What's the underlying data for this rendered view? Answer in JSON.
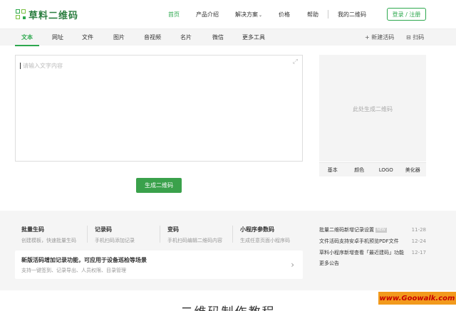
{
  "logo": {
    "text": "草料二维码",
    "icon": "qr-logo-icon"
  },
  "nav": {
    "items": [
      {
        "label": "首页",
        "active": true
      },
      {
        "label": "产品介绍"
      },
      {
        "label": "解决方案"
      },
      {
        "label": "价格"
      },
      {
        "label": "帮助"
      }
    ],
    "dropdown_icon": "⌄",
    "my_qr": "我的二维码",
    "login": "登录 / 注册"
  },
  "tabs": {
    "items": [
      "文本",
      "网址",
      "文件",
      "图片",
      "音视频",
      "名片",
      "微信",
      "更多工具"
    ],
    "active": "文本",
    "new_live": "+ 新建活码",
    "scan": "⊟ 扫码"
  },
  "editor": {
    "placeholder": "请输入文字内容",
    "expand_icon": "⤢"
  },
  "generate_button": "生成二维码",
  "qr_panel": {
    "hint": "此处生成二维码",
    "tabs": [
      "基本",
      "颜色",
      "LOGO",
      "美化器"
    ]
  },
  "features": [
    {
      "title": "批量生码",
      "desc": "创建模板，快速批量生码"
    },
    {
      "title": "记录码",
      "desc": "手机扫码添加记录"
    },
    {
      "title": "变码",
      "desc": "手机扫码编辑二维码内容"
    },
    {
      "title": "小程序参数码",
      "desc": "生成任意页面小程序码"
    }
  ],
  "banner": {
    "title": "新版活码增加记录功能，可应用于设备巡检等场景",
    "desc": "支持一键签到、记录导出、人员权限、目录管理",
    "arrow": "›"
  },
  "news": {
    "items": [
      {
        "text": "批量二维码新增记录设置",
        "badge": "NEW",
        "date": "11-28"
      },
      {
        "text": "文件活码支持安卓手机预览PDF文件",
        "date": "12-24"
      },
      {
        "text": "草料小程序新增查看「最近建码」功能",
        "date": "12-17"
      }
    ],
    "more": "更多公告"
  },
  "tutorial_title": "二维码制作教程",
  "watermark": "www.Goowalk.com",
  "colors": {
    "accent": "#2da84e",
    "button": "#3aa14b",
    "watermark_bg": "#f29a1d"
  }
}
